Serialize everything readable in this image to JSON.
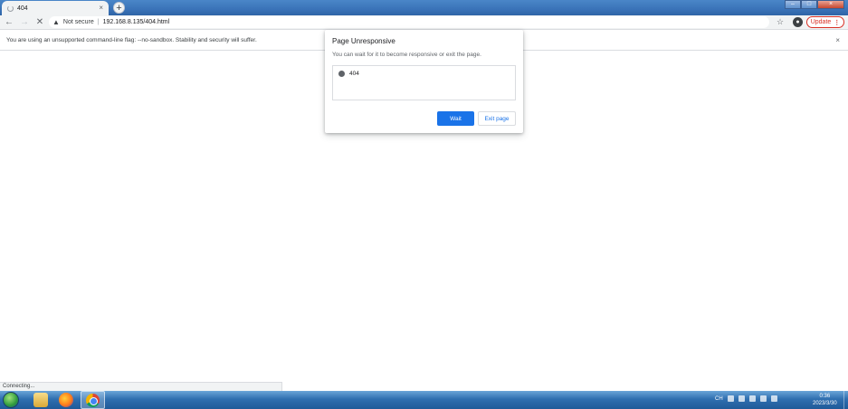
{
  "tab": {
    "title": "404",
    "close": "×",
    "new_tab": "+"
  },
  "window_controls": {
    "minimize": "–",
    "maximize": "□",
    "close": "×"
  },
  "toolbar": {
    "back": "←",
    "forward": "→",
    "stop": "✕",
    "security_label": "Not secure",
    "separator": "|",
    "url": "192.168.8.135/404.html",
    "bookmark_star": "☆",
    "profile": "●",
    "update_label": "Update",
    "menu": "⋮"
  },
  "infobar": {
    "message": "You are using an unsupported command-line flag: --no-sandbox. Stability and security will suffer.",
    "close": "×"
  },
  "dialog": {
    "title": "Page Unresponsive",
    "message": "You can wait for it to become responsive or exit the page.",
    "pages": [
      {
        "label": "404"
      }
    ],
    "wait_label": "Wait",
    "exit_label": "Exit page"
  },
  "status": {
    "text": "Connecting..."
  },
  "taskbar": {
    "tray_text": "CH",
    "time": "0:36",
    "date": "2023/3/30"
  },
  "colors": {
    "accent": "#1a73e8",
    "update_red": "#d93025",
    "toolbar_bg": "#f1f3f4"
  }
}
